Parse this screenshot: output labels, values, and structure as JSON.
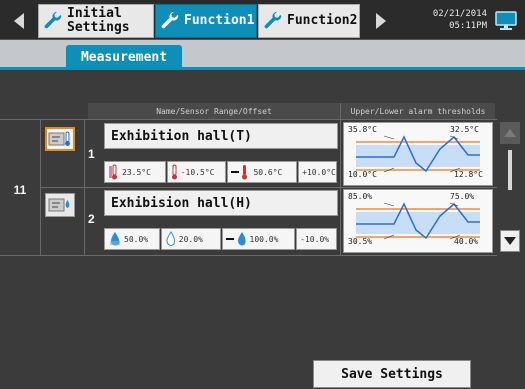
{
  "topbar": {
    "tabs": [
      {
        "line1": "Initial",
        "line2": "Settings",
        "active": false,
        "icon": "wrench-icon"
      },
      {
        "label": "Function1",
        "active": true,
        "icon": "wrench-icon"
      },
      {
        "label": "Function2",
        "active": false,
        "icon": "wrench-icon"
      }
    ],
    "date": "02/21/2014",
    "time": "05:11PM",
    "left_arrow_icon": "left-arrow-icon",
    "right_arrow_icon": "right-arrow-icon",
    "monitor_icon": "monitor-icon"
  },
  "subtabs": [
    "Measurement"
  ],
  "table": {
    "header_name": "Name/Sensor Range/Offset",
    "header_thresholds": "Upper/Lower alarm thresholds",
    "group_number": "11",
    "rows": [
      {
        "number": "1",
        "name": "Exhibition hall(T)",
        "current": "23.5°C",
        "range_min": "-10.5°C",
        "range_max": "50.6°C",
        "offset": "+10.0°C",
        "threshold_upper_a": "35.8°C",
        "threshold_upper_b": "32.5°C",
        "threshold_lower_a": "10.0°C",
        "threshold_lower_b": "12.8°C",
        "icon": "temperature-sensor-icon",
        "selected": true
      },
      {
        "number": "2",
        "name": "Exhibision hall(H)",
        "current": "50.0%",
        "range_min": "20.0%",
        "range_max": "100.0%",
        "offset": "-10.0%",
        "threshold_upper_a": "85.0%",
        "threshold_upper_b": "75.0%",
        "threshold_lower_a": "30.5%",
        "threshold_lower_b": "40.0%",
        "icon": "humidity-sensor-icon",
        "selected": false
      }
    ]
  },
  "save_button": "Save Settings",
  "colors": {
    "accent": "#0e8fb8",
    "selected_border": "#e88a1a",
    "background": "#3b3b3b"
  }
}
